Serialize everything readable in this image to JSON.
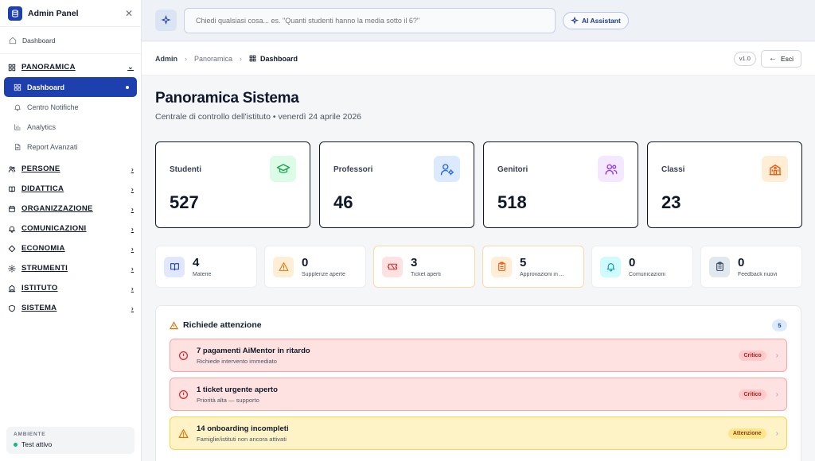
{
  "sidebar": {
    "title": "Admin Panel",
    "close": "✕",
    "quick_link": "Dashboard",
    "sections": [
      {
        "label": "PANORAMICA",
        "expanded": true,
        "icon": "grid-icon",
        "items": [
          {
            "label": "Dashboard",
            "active": true,
            "icon": "grid-icon"
          },
          {
            "label": "Centro Notifiche",
            "icon": "bell-icon"
          },
          {
            "label": "Analytics",
            "icon": "bar-chart-icon"
          },
          {
            "label": "Report Avanzati",
            "icon": "file-icon"
          }
        ]
      },
      {
        "label": "PERSONE",
        "icon": "users-icon"
      },
      {
        "label": "DIDATTICA",
        "icon": "book-icon"
      },
      {
        "label": "ORGANIZZAZIONE",
        "icon": "calendar-icon"
      },
      {
        "label": "COMUNICAZIONI",
        "icon": "bell-icon"
      },
      {
        "label": "ECONOMIA",
        "icon": "diamond-icon"
      },
      {
        "label": "STRUMENTI",
        "icon": "gear-icon"
      },
      {
        "label": "ISTITUTO",
        "icon": "building-icon"
      },
      {
        "label": "SISTEMA",
        "icon": "shield-icon"
      }
    ],
    "env_label": "AMBIENTE",
    "env_value": "Test attivo"
  },
  "topbar": {
    "search_placeholder": "Chiedi qualsiasi cosa... es. \"Quanti studenti hanno la media sotto il 6?\"",
    "ai_label": "AI Assistant"
  },
  "breadcrumb": [
    "Admin",
    "Panoramica",
    "Dashboard"
  ],
  "version": "v1.0",
  "exit_label": "Esci",
  "page": {
    "title": "Panoramica Sistema",
    "subtitle": "Centrale di controllo dell'istituto • venerdì 24 aprile 2026"
  },
  "stats": [
    {
      "label": "Studenti",
      "value": "527",
      "icon": "graduation-cap-icon",
      "color": "#16a34a",
      "bg": "#dcfce7"
    },
    {
      "label": "Professori",
      "value": "46",
      "icon": "user-cog-icon",
      "color": "#2563eb",
      "bg": "#dbeafe"
    },
    {
      "label": "Genitori",
      "value": "518",
      "icon": "users-icon",
      "color": "#9333ea",
      "bg": "#f3e8ff"
    },
    {
      "label": "Classi",
      "value": "23",
      "icon": "school-icon",
      "color": "#ea580c",
      "bg": "#ffedd5"
    }
  ],
  "minis": [
    {
      "value": "4",
      "label": "Materie",
      "icon": "book-open-icon",
      "color": "#1e40af",
      "bg": "#e0e7ff"
    },
    {
      "value": "0",
      "label": "Supplenze aperte",
      "icon": "warning-icon",
      "color": "#d97706",
      "bg": "#ffedd5"
    },
    {
      "value": "3",
      "label": "Ticket aperti",
      "icon": "ticket-icon",
      "color": "#dc2626",
      "bg": "#fee2e2",
      "warn": true
    },
    {
      "value": "5",
      "label": "Approvazioni in ...",
      "icon": "clipboard-icon",
      "color": "#ea580c",
      "bg": "#ffedd5",
      "warn": true
    },
    {
      "value": "0",
      "label": "Comunicazioni",
      "icon": "bell-icon",
      "color": "#0891b2",
      "bg": "#cffafe"
    },
    {
      "value": "0",
      "label": "Feedback nuovi",
      "icon": "clipboard-list-icon",
      "color": "#334155",
      "bg": "#e2e8f0"
    }
  ],
  "attention": {
    "title": "Richiede attenzione",
    "count": "5",
    "items": [
      {
        "title": "7 pagamenti AiMentor in ritardo",
        "sub": "Richiede intervento immediato",
        "badge": "Critico",
        "level": "crit"
      },
      {
        "title": "1 ticket urgente aperto",
        "sub": "Priorità alta — supporto",
        "badge": "Critico",
        "level": "crit"
      },
      {
        "title": "14 onboarding incompleti",
        "sub": "Famiglie/istituti non ancora attivati",
        "badge": "Attenzione",
        "level": "warn"
      }
    ]
  }
}
